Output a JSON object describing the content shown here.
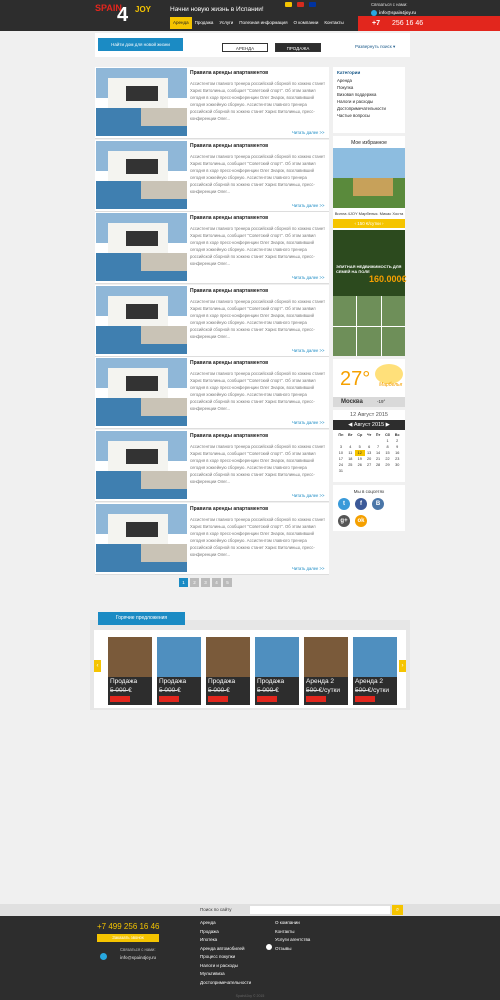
{
  "header": {
    "logo": {
      "word": "SPAIN",
      "num": "4",
      "suffix": "JOY"
    },
    "slogan": "Начни новую жизнь в Испании!",
    "nav": [
      "Аренда",
      "Продажа",
      "Услуги",
      "Полезная информация",
      "О компании",
      "Контакты"
    ],
    "contact": {
      "label": "Связаться с нами:",
      "email": "info@spain4joy.ru"
    },
    "phone": {
      "code": "+7",
      "number": "256 16 46"
    },
    "flag_colors": [
      "#f5c400",
      "#d52b1e",
      "#0033a0"
    ]
  },
  "search_bar": {
    "find_button": "Найти дом для новой жизни",
    "tabs": [
      "АРЕНДА",
      "ПРОДАЖА"
    ],
    "expand": "Развернуть поиск"
  },
  "articles": [
    {
      "title": "Правила аренды апартаментов",
      "text": "Ассистентом главного тренера российской сборной по хоккею станет Харис Витолиньш, сообщает \"Советский спорт\". Об этом заявил сегодня в ходе пресс-конференции Олег Знарок, возглавивший сегодня хоккейную сборную. Ассистентом главного тренера российской сборной по хоккею станет Харис Витолиньш, пресс-конференции Олег...",
      "more": "Читать далее >>"
    },
    {
      "title": "Правила аренды апартаментов",
      "text": "Ассистентом главного тренера российской сборной по хоккею станет Харис Витолиньш, сообщает \"Советский спорт\". Об этом заявил сегодня в ходе пресс-конференции Олег Знарок, возглавивший сегодня хоккейную сборную. Ассистентом главного тренера российской сборной по хоккею станет Харис Витолиньш, пресс-конференции Олег...",
      "more": "Читать далее >>"
    },
    {
      "title": "Правила аренды апартаментов",
      "text": "Ассистентом главного тренера российской сборной по хоккею станет Харис Витолиньш, сообщает \"Советский спорт\". Об этом заявил сегодня в ходе пресс-конференции Олег Знарок, возглавивший сегодня хоккейную сборную. Ассистентом главного тренера российской сборной по хоккею станет Харис Витолиньш, пресс-конференции Олег...",
      "more": "Читать далее >>"
    },
    {
      "title": "Правила аренды апартаментов",
      "text": "Ассистентом главного тренера российской сборной по хоккею станет Харис Витолиньш, сообщает \"Советский спорт\". Об этом заявил сегодня в ходе пресс-конференции Олег Знарок, возглавивший сегодня хоккейную сборную. Ассистентом главного тренера российской сборной по хоккею станет Харис Витолиньш, пресс-конференции Олег...",
      "more": "Читать далее >>"
    },
    {
      "title": "Правила аренды апартаментов",
      "text": "Ассистентом главного тренера российской сборной по хоккею станет Харис Витолиньш, сообщает \"Советский спорт\". Об этом заявил сегодня в ходе пресс-конференции Олег Знарок, возглавивший сегодня хоккейную сборную. Ассистентом главного тренера российской сборной по хоккею станет Харис Витолиньш, пресс-конференции Олег...",
      "more": "Читать далее >>"
    },
    {
      "title": "Правила аренды апартаментов",
      "text": "Ассистентом главного тренера российской сборной по хоккею станет Харис Витолиньш, сообщает \"Советский спорт\". Об этом заявил сегодня в ходе пресс-конференции Олег Знарок, возглавивший сегодня хоккейную сборную. Ассистентом главного тренера российской сборной по хоккею станет Харис Витолиньш, пресс-конференции Олег...",
      "more": "Читать далее >>"
    },
    {
      "title": "Правила аренды апартаментов",
      "text": "Ассистентом главного тренера российской сборной по хоккею станет Харис Витолиньш, сообщает \"Советский спорт\". Об этом заявил сегодня в ходе пресс-конференции Олег Знарок, возглавивший сегодня хоккейную сборную. Ассистентом главного тренера российской сборной по хоккею станет Харис Витолиньш, пресс-конференции Олег...",
      "more": "Читать далее >>"
    }
  ],
  "pager": [
    "1",
    "2",
    "3",
    "4",
    "5"
  ],
  "sidebar": {
    "categories": {
      "title": "Категории",
      "items": [
        "Аренда",
        "Покупка",
        "Визовая поддержка",
        "Налоги и расходы",
        "Достопримечательности",
        "Частые вопросы"
      ]
    },
    "favorite": {
      "title": "Мое избранное",
      "caption": "Вилла 4JOY Марбелья. Микас Хоста",
      "button": "150 €/сутки",
      "ad_text": "ЭЛИТНАЯ НЕДВИЖИМОСТЬ ДЛЯ СЕМЕЙ НА ПОЛЕ",
      "ad_price": "160.000€"
    },
    "weather": {
      "temp": "27°",
      "city_caption": "Марбелья",
      "city2": "Москва",
      "temp2": "-19°"
    },
    "calendar": {
      "date": "12 Август 2015",
      "month": "Август 2015",
      "days": [
        "Пн",
        "Вт",
        "Ср",
        "Чт",
        "Пт",
        "Сб",
        "Вс"
      ],
      "weeks": [
        [
          "",
          "",
          "",
          "",
          "",
          "1",
          "2"
        ],
        [
          "3",
          "4",
          "5",
          "6",
          "7",
          "8",
          "9"
        ],
        [
          "10",
          "11",
          "12",
          "13",
          "14",
          "15",
          "16"
        ],
        [
          "17",
          "18",
          "19",
          "20",
          "21",
          "22",
          "23"
        ],
        [
          "24",
          "25",
          "26",
          "27",
          "28",
          "29",
          "30"
        ],
        [
          "31",
          "",
          "",
          "",
          "",
          "",
          ""
        ]
      ]
    },
    "social": {
      "title": "Мы в соцсетях",
      "icons": [
        "t",
        "f",
        "B",
        "g+",
        "ok"
      ]
    }
  },
  "hot": {
    "title": "Горячие предложения",
    "items": [
      {
        "label": "Продажа",
        "price": "5 000 ",
        "cur": "€"
      },
      {
        "label": "Продажа",
        "price": "5 000 ",
        "cur": "€"
      },
      {
        "label": "Продажа",
        "price": "5 000 ",
        "cur": "€"
      },
      {
        "label": "Продажа",
        "price": "5 000 ",
        "cur": "€"
      },
      {
        "label": "Аренда 2",
        "price": "500 ",
        "cur": "€/сутки"
      },
      {
        "label": "Аренда 2",
        "price": "500 ",
        "cur": "€/сутки"
      }
    ]
  },
  "footer": {
    "search_label": "Поиск по сайту",
    "phone": "+7 499 256 16 46",
    "call_button": "Заказать звонок",
    "contact_label": "Связаться с нами:",
    "email": "info@spain4joy.ru",
    "col1": [
      "Аренда",
      "Продажа",
      "Ипотека",
      "Аренда автомобилей",
      "Процесс покупки",
      "Налоги и расходы",
      "Мультивиза",
      "Достопримечательности"
    ],
    "col2": [
      "О компании",
      "Контакты",
      "Услуги агентства",
      "Отзывы"
    ],
    "copyright": "Spain4Joy © 2015"
  }
}
